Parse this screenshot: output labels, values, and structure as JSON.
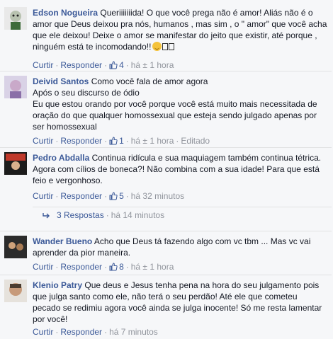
{
  "colors": {
    "link": "#3b5998",
    "meta": "#90949c",
    "text": "#141823",
    "background": "#f6f7f9"
  },
  "comments": [
    {
      "author": "Edson Nogueira",
      "body": "Queriiiiiiida! O que você prega não é amor! Aliás não é o amor que Deus deixou pra nós, humanos , mas sim , o \" amor\" que você acha que ele deixou! Deixe o amor se manifestar do jeito que existir, até porque , ninguém está te incomodando!!",
      "reply_label": "Curtir",
      "respond_label": "Responder",
      "likes": "4",
      "time": "há ± 1 hora",
      "edited": ""
    },
    {
      "author": "Deivid Santos",
      "body": "Como você fala de amor agora\nApós o seu discurso de ódio\nEu que estou orando por você porque você está muito mais necessitada de oração do que qualquer homossexual que esteja sendo julgado apenas por ser homossexual",
      "reply_label": "Curtir",
      "respond_label": "Responder",
      "likes": "1",
      "time": "há ± 1 hora",
      "edited": "Editado"
    },
    {
      "author": "Pedro Abdalla",
      "body": "Continua ridícula e sua maquiagem também continua tétrica. Agora com cílios de boneca?! Não combina com a sua idade! Para que está feio e vergonhoso.",
      "reply_label": "Curtir",
      "respond_label": "Responder",
      "likes": "5",
      "time": "há 32 minutos",
      "edited": ""
    },
    {
      "author": "Wander Bueno",
      "body": "Acho que Deus tá fazendo algo com vc tbm ... Mas vc vai aprender da pior maneira.",
      "reply_label": "Curtir",
      "respond_label": "Responder",
      "likes": "8",
      "time": "há ± 1 hora",
      "edited": ""
    },
    {
      "author": "Klenio Patry",
      "body": "Que deus e Jesus tenha pena na hora do seu julgamento pois que julga santo como ele, não terá o seu perdão! Até ele que cometeu pecado se redimiu agora você ainda se julga inocente! Só me resta lamentar por você!",
      "reply_label": "Curtir",
      "respond_label": "Responder",
      "likes": "",
      "time": "há 7 minutos",
      "edited": ""
    }
  ],
  "replies_link": {
    "label": "3 Respostas",
    "time": "há 14 minutos"
  },
  "icons": {
    "like": "thumbs-up-icon",
    "reply": "reply-arrow-icon",
    "emoji": "smiley-emoji-icon"
  }
}
